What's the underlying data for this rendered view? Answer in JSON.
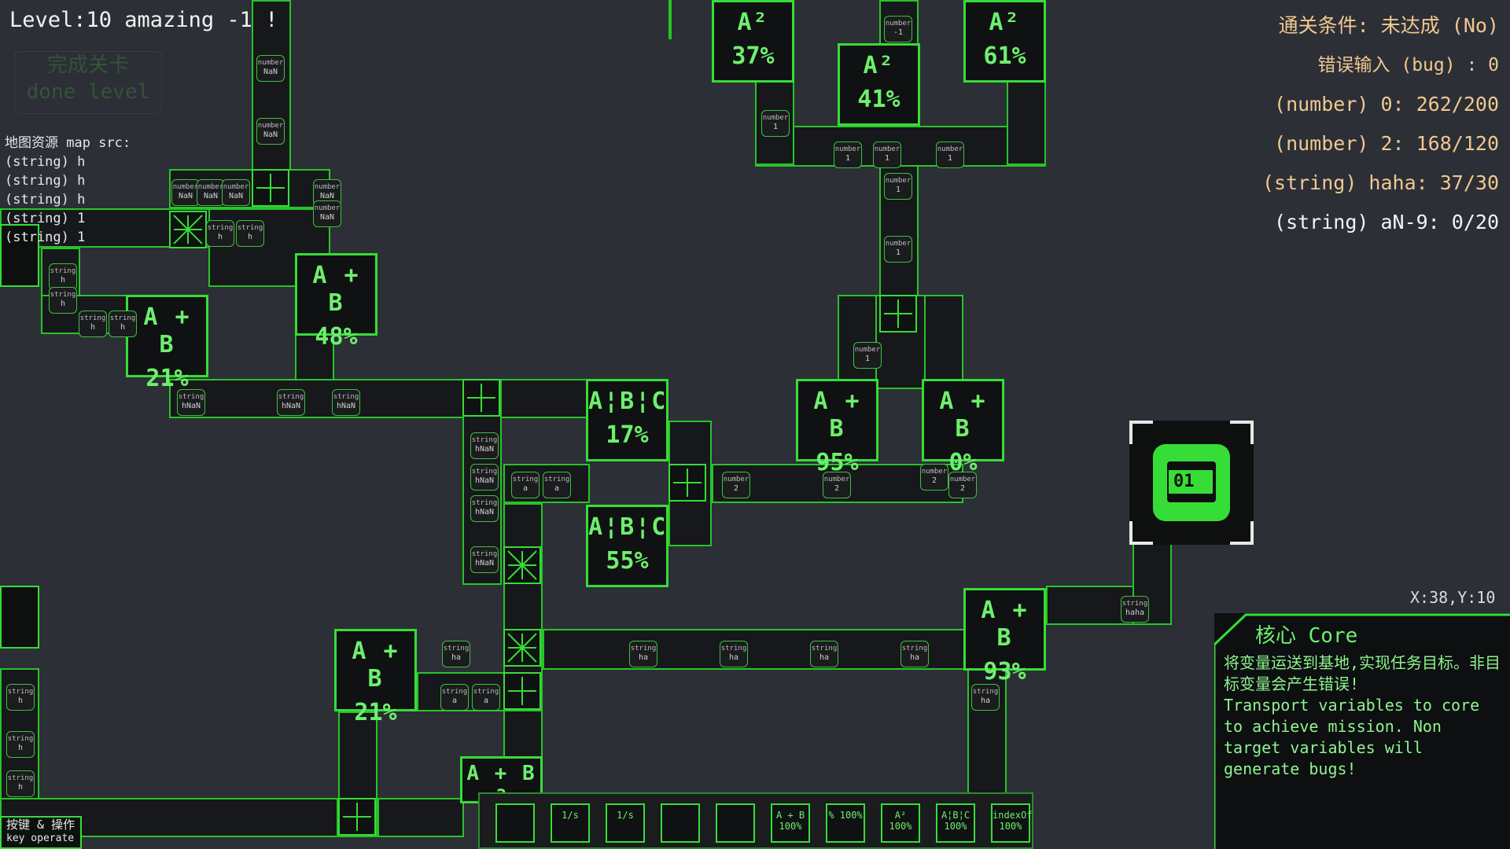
{
  "hud": {
    "level_text": "Level:10 amazing -1 !",
    "done_button_cn": "完成关卡",
    "done_button_en": "done level",
    "map_src_title": "地图资源 map src:",
    "map_src_items": [
      "(string) h",
      "(string) h",
      "(string) h",
      "(string) 1",
      "(string) 1"
    ],
    "coords": "X:38,Y:10",
    "key_op_cn": "按键 & 操作",
    "key_op_en": "key operate"
  },
  "goals": {
    "condition": "通关条件: 未达成 (No)",
    "bug_input": "错误输入 (bug) : 0",
    "items": [
      "(number) 0: 262/200",
      "(number) 2: 168/120",
      "(string) haha: 37/30",
      "(string) aN-9: 0/20"
    ]
  },
  "core": {
    "title": "核心 Core",
    "text_cn": "将变量运送到基地,实现任务目标。非目标变量会产生错误!",
    "text_en": "Transport variables to core to achieve mission. Non target variables will generate bugs!",
    "chip_label": "01"
  },
  "processors": [
    {
      "op": "A²",
      "pct": "37%"
    },
    {
      "op": "A²",
      "pct": "41%"
    },
    {
      "op": "A²",
      "pct": "61%"
    },
    {
      "op": "A + B",
      "pct": "48%"
    },
    {
      "op": "A + B",
      "pct": "21%"
    },
    {
      "op": "A¦B¦C",
      "pct": "17%"
    },
    {
      "op": "A¦B¦C",
      "pct": "55%"
    },
    {
      "op": "A + B",
      "pct": "95%"
    },
    {
      "op": "A + B",
      "pct": "0%"
    },
    {
      "op": "A + B",
      "pct": "93%"
    },
    {
      "op": "A + B",
      "pct": "21%"
    },
    {
      "op": "A + B",
      "pct": "3"
    }
  ],
  "chips": [
    {
      "t": "number",
      "v": "NaN"
    },
    {
      "t": "number",
      "v": "NaN"
    },
    {
      "t": "number",
      "v": "NaN"
    },
    {
      "t": "number",
      "v": "NaN"
    },
    {
      "t": "number",
      "v": "NaN"
    },
    {
      "t": "number",
      "v": "NaN"
    },
    {
      "t": "number",
      "v": "NaN"
    },
    {
      "t": "string",
      "v": "h"
    },
    {
      "t": "string",
      "v": "h"
    },
    {
      "t": "string",
      "v": "h"
    },
    {
      "t": "string",
      "v": "h"
    },
    {
      "t": "string",
      "v": "h"
    },
    {
      "t": "string",
      "v": "h"
    },
    {
      "t": "string",
      "v": "hNaN"
    },
    {
      "t": "string",
      "v": "hNaN"
    },
    {
      "t": "string",
      "v": "hNaN"
    },
    {
      "t": "string",
      "v": "hNaN"
    },
    {
      "t": "string",
      "v": "hNaN"
    },
    {
      "t": "string",
      "v": "hNaN"
    },
    {
      "t": "string",
      "v": "hNaN"
    },
    {
      "t": "string",
      "v": "a"
    },
    {
      "t": "string",
      "v": "a"
    },
    {
      "t": "string",
      "v": "a"
    },
    {
      "t": "string",
      "v": "a"
    },
    {
      "t": "number",
      "v": "-1"
    },
    {
      "t": "number",
      "v": "1"
    },
    {
      "t": "number",
      "v": "1"
    },
    {
      "t": "number",
      "v": "1"
    },
    {
      "t": "number",
      "v": "1"
    },
    {
      "t": "number",
      "v": "1"
    },
    {
      "t": "number",
      "v": "1"
    },
    {
      "t": "number",
      "v": "1"
    },
    {
      "t": "number",
      "v": "2"
    },
    {
      "t": "number",
      "v": "2"
    },
    {
      "t": "number",
      "v": "2"
    },
    {
      "t": "number",
      "v": "2"
    },
    {
      "t": "string",
      "v": "ha"
    },
    {
      "t": "string",
      "v": "ha"
    },
    {
      "t": "string",
      "v": "ha"
    },
    {
      "t": "string",
      "v": "ha"
    },
    {
      "t": "string",
      "v": "ha"
    },
    {
      "t": "string",
      "v": "ha"
    },
    {
      "t": "string",
      "v": "haha"
    },
    {
      "t": "string",
      "v": "h"
    },
    {
      "t": "string",
      "v": "h"
    },
    {
      "t": "string",
      "v": "h"
    }
  ],
  "toolbar": [
    {
      "label": ""
    },
    {
      "label": "1/s"
    },
    {
      "label": ""
    },
    {
      "label": ""
    },
    {
      "label": "A + B\n100%"
    },
    {
      "label": "%\n100%"
    },
    {
      "label": "A²\n100%"
    },
    {
      "label": "A¦B¦C\n100%"
    },
    {
      "label": "indexOf\n100%"
    }
  ],
  "colors": {
    "accent": "#36dd36",
    "background": "#2c2f36",
    "goal_text": "#f0c890"
  }
}
